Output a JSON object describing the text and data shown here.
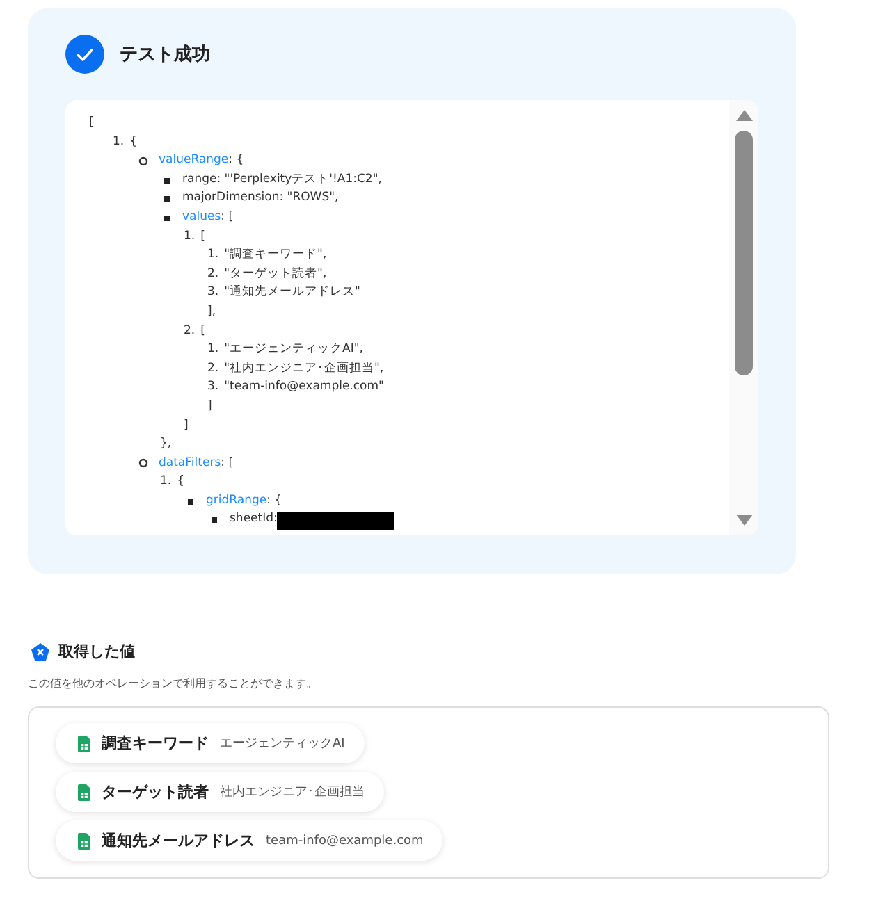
{
  "result": {
    "title": "テスト成功",
    "tree": [
      {
        "text": "[",
        "children": [
          {
            "kind": "number",
            "marker": "1.",
            "text": "{",
            "children": [
              {
                "kind": "circle",
                "key": "valueRange",
                "text": ": {",
                "children": [
                  {
                    "kind": "square",
                    "text": "range: \"'Perplexityテスト'!A1:C2\","
                  },
                  {
                    "kind": "square",
                    "text": "majorDimension: \"ROWS\","
                  },
                  {
                    "kind": "square",
                    "key": "values",
                    "text": ": [",
                    "children": [
                      {
                        "kind": "number",
                        "marker": "1.",
                        "text": "[",
                        "children": [
                          {
                            "kind": "number",
                            "marker": "1.",
                            "text": "\"調査キーワード\","
                          },
                          {
                            "kind": "number",
                            "marker": "2.",
                            "text": "\"ターゲット読者\","
                          },
                          {
                            "kind": "number",
                            "marker": "3.",
                            "text": "\"通知先メールアドレス\""
                          }
                        ],
                        "close": "],"
                      },
                      {
                        "kind": "number",
                        "marker": "2.",
                        "text": "[",
                        "children": [
                          {
                            "kind": "number",
                            "marker": "1.",
                            "text": "\"エージェンティックAI\","
                          },
                          {
                            "kind": "number",
                            "marker": "2.",
                            "text": "\"社内エンジニア･企画担当\","
                          },
                          {
                            "kind": "number",
                            "marker": "3.",
                            "text": "\"team-info@example.com\""
                          }
                        ],
                        "close": "]"
                      }
                    ],
                    "close": "]"
                  }
                ],
                "close": "},"
              },
              {
                "kind": "circle",
                "key": "dataFilters",
                "text": ": [",
                "children": [
                  {
                    "kind": "number",
                    "marker": "1.",
                    "text": "{",
                    "children": [
                      {
                        "kind": "square",
                        "key": "gridRange",
                        "text": ": {",
                        "children": [
                          {
                            "kind": "square",
                            "text": "sheetId:",
                            "redacted": true
                          }
                        ]
                      }
                    ]
                  }
                ]
              }
            ]
          }
        ]
      }
    ]
  },
  "values": {
    "title": "取得した値",
    "description": "この値を他のオペレーションで利用することができます。",
    "items": [
      {
        "label": "調査キーワード",
        "value": "エージェンティックAI"
      },
      {
        "label": "ターゲット読者",
        "value": "社内エンジニア･企画担当"
      },
      {
        "label": "通知先メールアドレス",
        "value": "team-info@example.com"
      }
    ]
  }
}
